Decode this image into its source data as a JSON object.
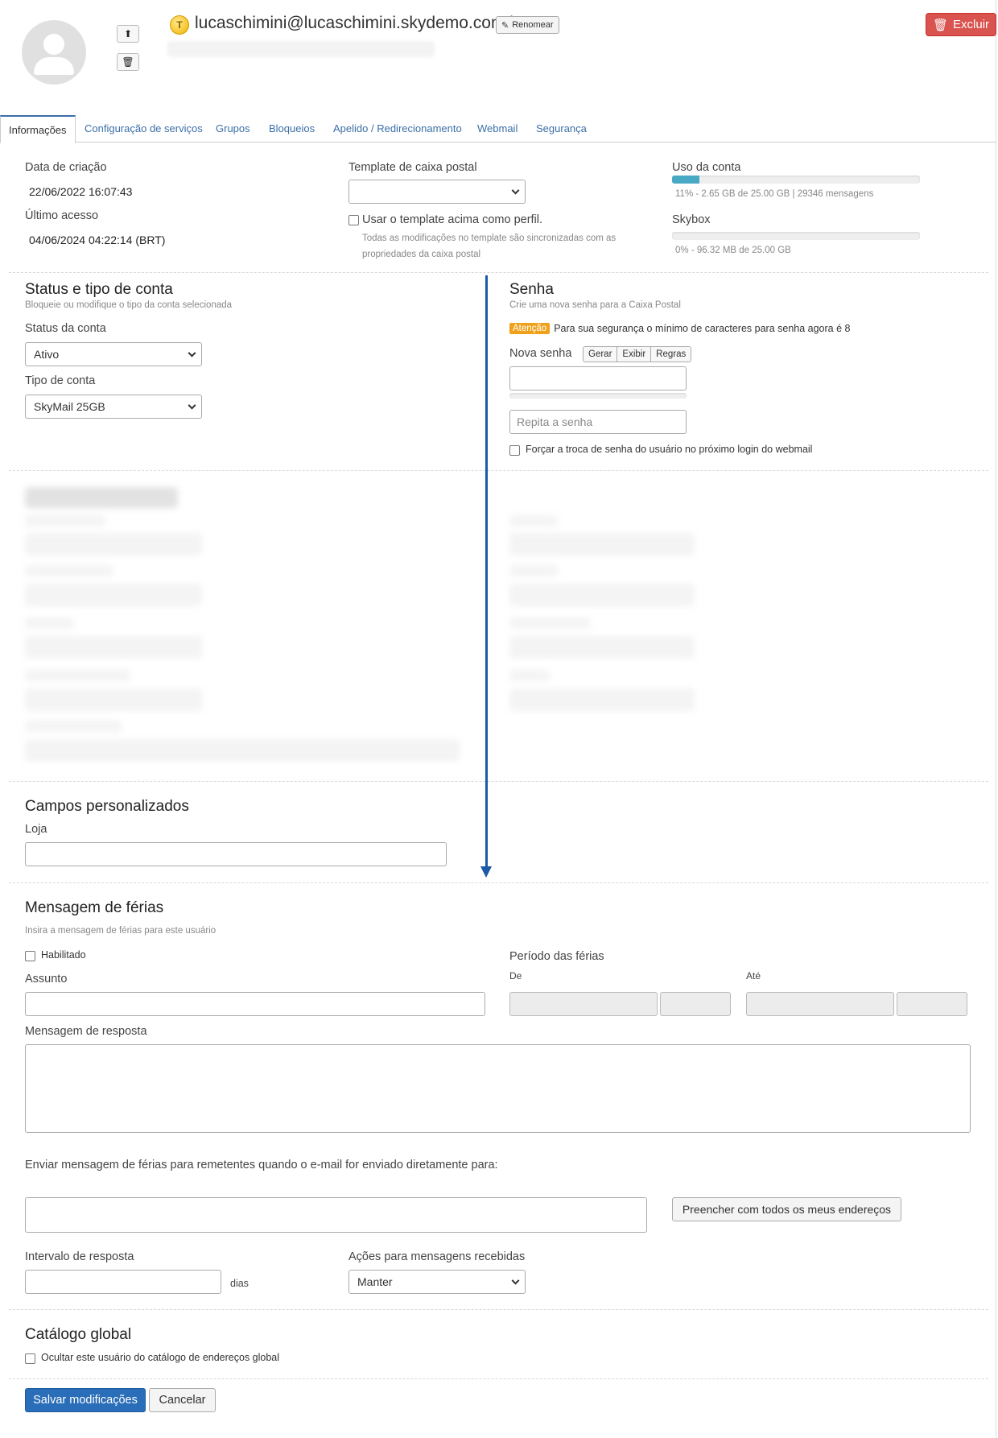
{
  "header": {
    "email": "lucaschimini@lucaschimini.skydemo.com.br",
    "badge_letter": "T",
    "rename_label": "Renomear",
    "delete_label": "Excluir"
  },
  "tabs": [
    {
      "label": "Informações",
      "active": true
    },
    {
      "label": "Configuração de serviços"
    },
    {
      "label": "Grupos"
    },
    {
      "label": "Bloqueios"
    },
    {
      "label": "Apelido / Redirecionamento"
    },
    {
      "label": "Webmail"
    },
    {
      "label": "Segurança"
    }
  ],
  "info": {
    "created_label": "Data de criação",
    "created_value": "22/06/2022 16:07:43",
    "last_access_label": "Último acesso",
    "last_access_value": "04/06/2024 04:22:14 (BRT)",
    "template_label": "Template de caixa postal",
    "template_value": "",
    "use_template_label": "Usar o template acima como perfil.",
    "template_note_1": "Todas as modificações no template são sincronizadas com as",
    "template_note_2": "propriedades da caixa postal",
    "usage_label": "Uso da conta",
    "usage_fraction": 0.11,
    "usage_text": "11% - 2.65 GB de 25.00 GB | 29346 mensagens",
    "skybox_label": "Skybox",
    "skybox_fraction": 0.0,
    "skybox_text": "0% - 96.32 MB de 25.00 GB"
  },
  "status": {
    "title": "Status e tipo de conta",
    "subtitle": "Bloqueie ou modifique o tipo da conta selecionada",
    "status_label": "Status da conta",
    "status_value": "Ativo",
    "type_label": "Tipo de conta",
    "type_value": "SkyMail 25GB"
  },
  "password": {
    "title": "Senha",
    "subtitle": "Crie uma nova senha para a Caixa Postal",
    "attention": "Atenção",
    "attention_text": "Para sua segurança o mínimo de caracteres para senha agora é 8",
    "new_label": "Nova senha",
    "btn_generate": "Gerar",
    "btn_show": "Exibir",
    "btn_rules": "Regras",
    "repeat_placeholder": "Repita a senha",
    "force_change_label": "Forçar a troca de senha do usuário no próximo login do webmail"
  },
  "custom": {
    "title": "Campos personalizados",
    "store_label": "Loja"
  },
  "vacation": {
    "title": "Mensagem de férias",
    "subtitle": "Insira a mensagem de férias para este usuário",
    "enabled_label": "Habilitado",
    "subject_label": "Assunto",
    "period_label": "Período das férias",
    "from_label": "De",
    "to_label": "Até",
    "reply_label": "Mensagem de resposta",
    "send_to_label": "Enviar mensagem de férias para remetentes quando o e-mail for enviado diretamente para:",
    "fill_all_label": "Preencher com todos os meus endereços",
    "interval_label": "Intervalo de resposta",
    "days_label": "dias",
    "actions_label": "Ações para mensagens recebidas",
    "actions_value": "Manter"
  },
  "catalog": {
    "title": "Catálogo global",
    "hide_label": "Ocultar este usuário do catálogo de endereços global"
  },
  "footer": {
    "save_label": "Salvar modificações",
    "cancel_label": "Cancelar"
  },
  "colors": {
    "accent": "#2a6db8",
    "danger": "#d9534f",
    "warning": "#f0a11b",
    "progress": "#48a9c5",
    "annotation_arrow": "#1a5aa6"
  }
}
